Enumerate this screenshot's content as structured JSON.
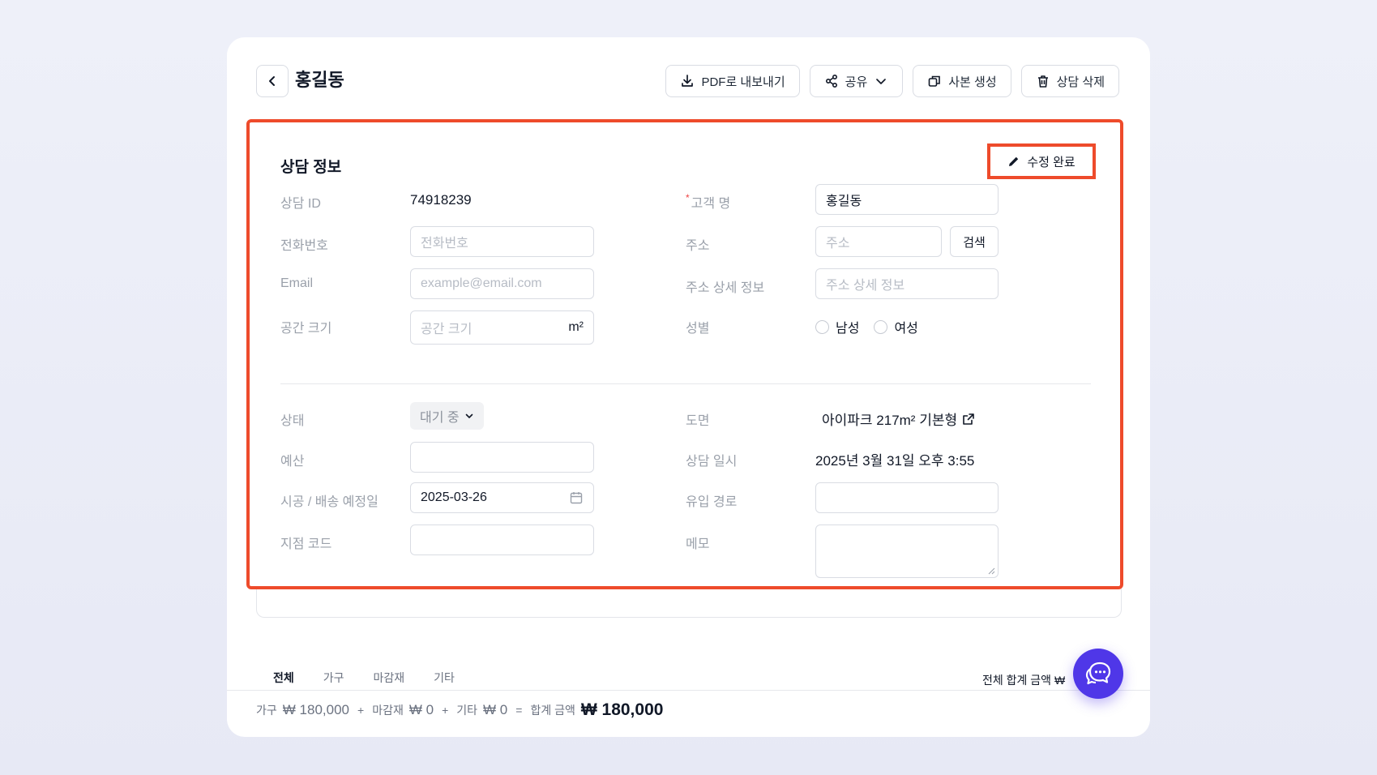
{
  "header": {
    "title": "홍길동",
    "actions": {
      "pdf": "PDF로 내보내기",
      "share": "공유",
      "copy": "사본 생성",
      "delete": "상담 삭제"
    }
  },
  "section": {
    "title": "상담 정보",
    "edit_done": "수정 완료"
  },
  "fields": {
    "consult_id": {
      "label": "상담 ID",
      "value": "74918239"
    },
    "phone": {
      "label": "전화번호",
      "placeholder": "전화번호"
    },
    "email": {
      "label": "Email",
      "placeholder": "example@email.com"
    },
    "space": {
      "label": "공간 크기",
      "placeholder": "공간 크기",
      "unit": "m²"
    },
    "customer": {
      "label": "고객 명",
      "required_mark": "*",
      "value": "홍길동"
    },
    "address": {
      "label": "주소",
      "placeholder": "주소",
      "search_button": "검색"
    },
    "address_detail": {
      "label": "주소 상세 정보",
      "placeholder": "주소 상세 정보"
    },
    "gender": {
      "label": "성별",
      "options": [
        "남성",
        "여성"
      ]
    },
    "status": {
      "label": "상태",
      "value": "대기 중"
    },
    "budget": {
      "label": "예산",
      "value": ""
    },
    "schedule": {
      "label": "시공 / 배송 예정일",
      "value": "2025-03-26"
    },
    "branch_code": {
      "label": "지점 코드",
      "value": ""
    },
    "floorplan": {
      "label": "도면",
      "value": "아이파크 217m² 기본형"
    },
    "consult_datetime": {
      "label": "상담 일시",
      "value": "2025년 3월 31일 오후 3:55"
    },
    "inflow": {
      "label": "유입 경로",
      "value": ""
    },
    "memo": {
      "label": "메모",
      "value": ""
    }
  },
  "tabs": [
    "전체",
    "가구",
    "마감재",
    "기타"
  ],
  "total_label": "전체 합계 금액 ₩",
  "summary": {
    "furniture_label": "가구",
    "furniture_amount": "₩ 180,000",
    "plus1": "+",
    "finish_label": "마감재",
    "finish_amount": "₩ 0",
    "plus2": "+",
    "etc_label": "기타",
    "etc_amount": "₩ 0",
    "equals": "=",
    "total_label": "합계 금액",
    "total_amount": "₩ 180,000"
  },
  "colors": {
    "highlight": "#ee4b2b",
    "fab": "#4f37e8"
  }
}
